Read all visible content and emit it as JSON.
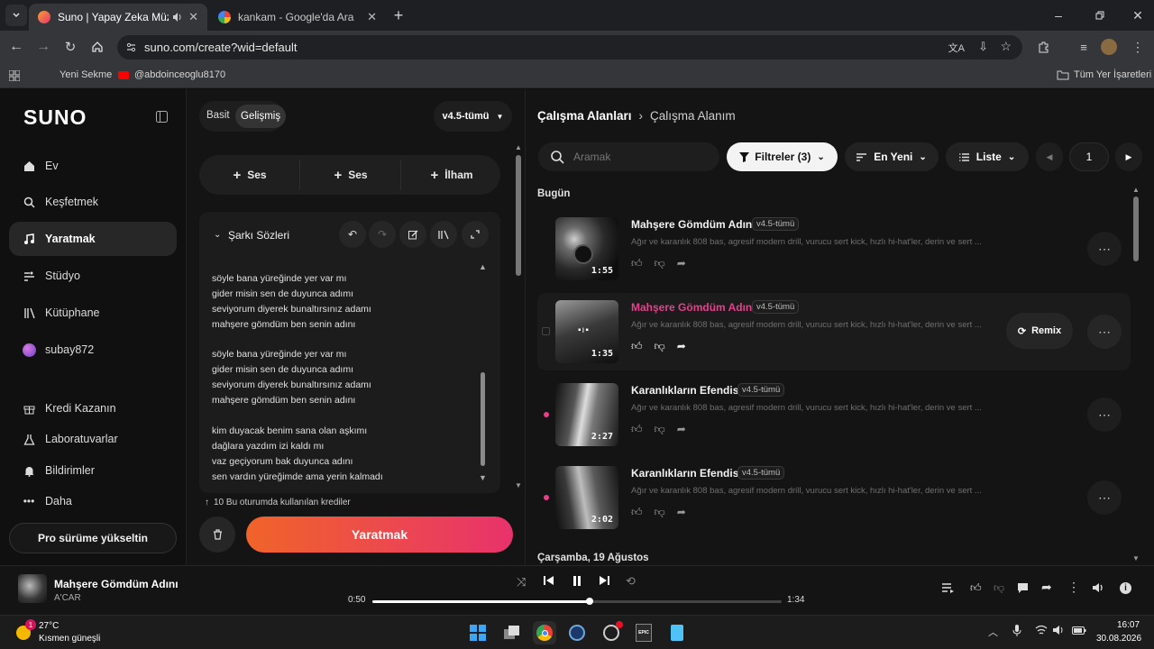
{
  "browser": {
    "tabs": [
      {
        "title": "Suno | Yapay Zeka Müziği",
        "active": true
      },
      {
        "title": "kankam - Google'da Ara",
        "active": false
      }
    ],
    "url": "suno.com/create?wid=default",
    "bookmarks": [
      {
        "label": "Yeni Sekme"
      },
      {
        "label": "@abdoinceoglu8170"
      }
    ],
    "bookmarks_right": "Tüm Yer İşaretleri"
  },
  "sidebar": {
    "logo": "SUNO",
    "items": [
      {
        "label": "Ev",
        "icon": "home-icon"
      },
      {
        "label": "Keşfetmek",
        "icon": "search-icon"
      },
      {
        "label": "Yaratmak",
        "icon": "music-note-icon",
        "active": true
      },
      {
        "label": "Stüdyo",
        "icon": "studio-icon"
      },
      {
        "label": "Kütüphane",
        "icon": "library-icon"
      },
      {
        "label": "subay872",
        "icon": "avatar"
      }
    ],
    "bottom_items": [
      {
        "label": "Kredi Kazanın",
        "icon": "gift-icon"
      },
      {
        "label": "Laboratuvarlar",
        "icon": "flask-icon"
      },
      {
        "label": "Bildirimler",
        "icon": "bell-icon"
      },
      {
        "label": "Daha",
        "icon": "dots-icon"
      }
    ],
    "upgrade_label": "Pro sürüme yükseltin"
  },
  "create": {
    "mode_simple": "Basit",
    "mode_advanced": "Gelişmiş",
    "model": "v4.5-tümü",
    "add_audio_1": "Ses",
    "add_audio_2": "Ses",
    "inspiration": "İlham",
    "lyrics_title": "Şarkı Sözleri",
    "lyrics": [
      "söyle bana yüreğinde yer var mı",
      "gider misin sen de duyunca adımı",
      "seviyorum diyerek bunaltırsınız adamı",
      "mahşere gömdüm ben senin adını",
      "",
      "söyle bana yüreğinde yer var mı",
      "gider misin sen de duyunca adımı",
      "seviyorum diyerek bunaltırsınız adamı",
      "mahşere gömdüm ben senin adını",
      "",
      "kim duyacak benim sana olan aşkımı",
      "dağlara yazdım izi kaldı mı",
      "vaz geçiyorum bak duyunca  adını",
      "sen vardın yüreğimde ama yerin kalmadı"
    ],
    "credits_note": "10 Bu oturumda kullanılan krediler",
    "create_button": "Yaratmak"
  },
  "library": {
    "breadcrumb_root": "Çalışma Alanları",
    "breadcrumb_current": "Çalışma Alanım",
    "search_placeholder": "Aramak",
    "filters_label": "Filtreler (3)",
    "sort_label": "En Yeni",
    "view_label": "Liste",
    "page": "1",
    "section_today": "Bugün",
    "section_next": "Çarşamba, 19 Ağustos",
    "remix_label": "Remix",
    "songs": [
      {
        "title": "Mahşere Gömdüm Adını",
        "version": "v4.5-tümü",
        "duration": "1:55",
        "desc": "Ağır ve karanlık 808 bas, agresif modern drill, vurucu sert kick, hızlı hi-hat'ler, derin ve sert ...",
        "playing": false
      },
      {
        "title": "Mahşere Gömdüm Adını",
        "version": "v4.5-tümü",
        "duration": "1:35",
        "desc": "Ağır ve karanlık 808 bas, agresif modern drill, vurucu sert kick, hızlı hi-hat'ler, derin ve sert ...",
        "playing": true
      },
      {
        "title": "Karanlıkların Efendisi",
        "version": "v4.5-tümü",
        "duration": "2:27",
        "desc": "Ağır ve karanlık 808 bas, agresif modern drill, vurucu sert kick, hızlı hi-hat'ler, derin ve sert ...",
        "playing": false
      },
      {
        "title": "Karanlıkların Efendisi",
        "version": "v4.5-tümü",
        "duration": "2:02",
        "desc": "Ağır ve karanlık 808 bas, agresif modern drill, vurucu sert kick, hızlı hi-hat'ler, derin ve sert ...",
        "playing": false
      }
    ]
  },
  "player": {
    "title": "Mahşere Gömdüm Adını",
    "artist": "A'CAR",
    "elapsed": "0:50",
    "total": "1:34",
    "progress": 0.53
  },
  "taskbar": {
    "weather_temp": "27°C",
    "weather_desc": "Kısmen güneşli",
    "weather_badge": "1",
    "time": "16:07",
    "date": "30.08.2026"
  },
  "colors": {
    "accent_pink": "#e83e8c",
    "create_gradient_start": "#f0642a",
    "create_gradient_end": "#e8326c"
  }
}
